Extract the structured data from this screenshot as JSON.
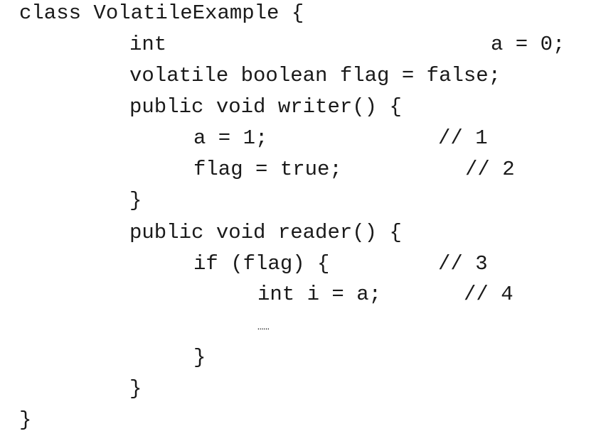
{
  "code": {
    "class_decl": "class VolatileExample {",
    "field_a_type": "int",
    "field_a_assign": "a = 0;",
    "field_flag": "volatile boolean flag = false;",
    "writer_sig": "public void writer() {",
    "writer_stmt1": "a = 1;",
    "writer_cmt1": "// 1",
    "writer_stmt2": "flag = true;",
    "writer_cmt2": "// 2",
    "writer_close": "}",
    "reader_sig": "public void reader() {",
    "if_stmt": "if (flag) {",
    "if_cmt": "// 3",
    "read_stmt": "int i = a;",
    "read_cmt": "// 4",
    "ellipsis": "……",
    "if_close": "}",
    "reader_close": "}",
    "class_close": "}"
  }
}
